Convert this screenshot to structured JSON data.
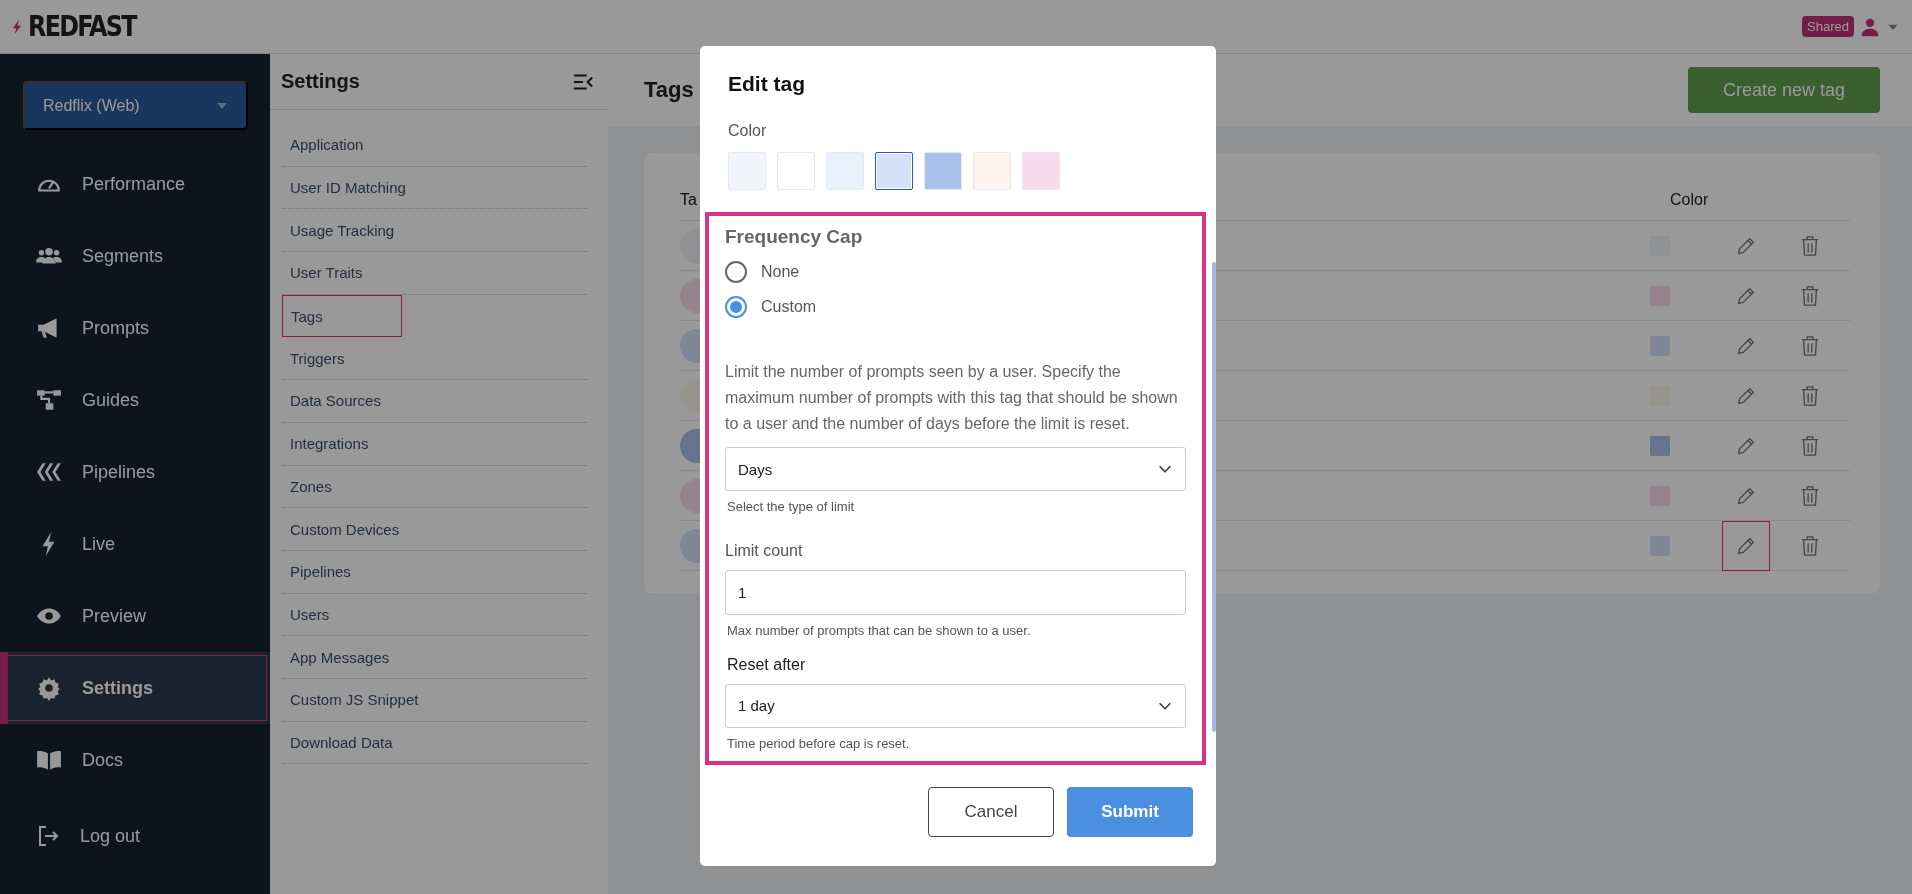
{
  "header": {
    "logo": "REDFAST",
    "badge": "Shared"
  },
  "app_selector": {
    "value": "Redflix (Web)"
  },
  "nav": [
    {
      "label": "Performance",
      "selected": false,
      "highlighted": false
    },
    {
      "label": "Segments",
      "selected": false,
      "highlighted": false
    },
    {
      "label": "Prompts",
      "selected": false,
      "highlighted": false
    },
    {
      "label": "Guides",
      "selected": false,
      "highlighted": false
    },
    {
      "label": "Pipelines",
      "selected": false,
      "highlighted": false
    },
    {
      "label": "Live",
      "selected": false,
      "highlighted": false
    },
    {
      "label": "Preview",
      "selected": false,
      "highlighted": false
    },
    {
      "label": "Settings",
      "selected": true,
      "highlighted": true
    },
    {
      "label": "Docs",
      "selected": false,
      "highlighted": false
    }
  ],
  "log_out": {
    "label": "Log out"
  },
  "settings_panel": {
    "title": "Settings",
    "items": [
      {
        "label": "Application",
        "highlighted": false
      },
      {
        "label": "User ID Matching",
        "highlighted": false
      },
      {
        "label": "Usage Tracking",
        "highlighted": false
      },
      {
        "label": "User Traits",
        "highlighted": false
      },
      {
        "label": "Tags",
        "highlighted": true
      },
      {
        "label": "Triggers",
        "highlighted": false
      },
      {
        "label": "Data Sources",
        "highlighted": false
      },
      {
        "label": "Integrations",
        "highlighted": false
      },
      {
        "label": "Zones",
        "highlighted": false
      },
      {
        "label": "Custom Devices",
        "highlighted": false
      },
      {
        "label": "Pipelines",
        "highlighted": false
      },
      {
        "label": "Users",
        "highlighted": false
      },
      {
        "label": "App Messages",
        "highlighted": false
      },
      {
        "label": "Custom JS Snippet",
        "highlighted": false
      },
      {
        "label": "Download Data",
        "highlighted": false
      }
    ]
  },
  "page": {
    "title": "Tags",
    "create_button": "Create new tag"
  },
  "table": {
    "columns": [
      "Ta",
      "Color"
    ],
    "rows": [
      {
        "color": "#8f9193",
        "edit_highlighted": false
      },
      {
        "color": "#95848d",
        "edit_highlighted": false
      },
      {
        "color": "#7f8694",
        "edit_highlighted": false
      },
      {
        "color": "#98948e",
        "edit_highlighted": false
      },
      {
        "color": "#65748c",
        "edit_highlighted": false
      },
      {
        "color": "#95848d",
        "edit_highlighted": false
      },
      {
        "color": "#7f8694",
        "edit_highlighted": true
      }
    ]
  },
  "modal": {
    "title": "Edit tag",
    "color_label": "Color",
    "swatches": [
      {
        "color": "#f1f4f8",
        "selected": false
      },
      {
        "color": "#ffffff",
        "selected": false
      },
      {
        "color": "#e8f1fc",
        "selected": false
      },
      {
        "color": "#d3e0f6",
        "selected": true
      },
      {
        "color": "#a8c1ea",
        "selected": false
      },
      {
        "color": "#fdf6ec",
        "selected": false
      },
      {
        "color": "#f8dceb",
        "selected": false
      }
    ],
    "frequency_cap": {
      "title": "Frequency Cap",
      "highlighted": true,
      "options": [
        {
          "label": "None",
          "selected": false
        },
        {
          "label": "Custom",
          "selected": true
        }
      ],
      "description": "Limit the number of prompts seen by a user. Specify the maximum number of prompts with this tag that should be shown to a user and the number of days before the limit is reset.",
      "limit_type": {
        "value": "Days",
        "hint": "Select the type of limit"
      },
      "limit_count": {
        "label": "Limit count",
        "value": "1",
        "hint": "Max number of prompts that can be shown to a user."
      },
      "reset_after": {
        "label": "Reset after",
        "value": "1 day",
        "hint": "Time period before cap is reset."
      }
    },
    "buttons": [
      {
        "label": "Cancel",
        "kind": "secondary"
      },
      {
        "label": "Submit",
        "kind": "primary"
      }
    ]
  }
}
